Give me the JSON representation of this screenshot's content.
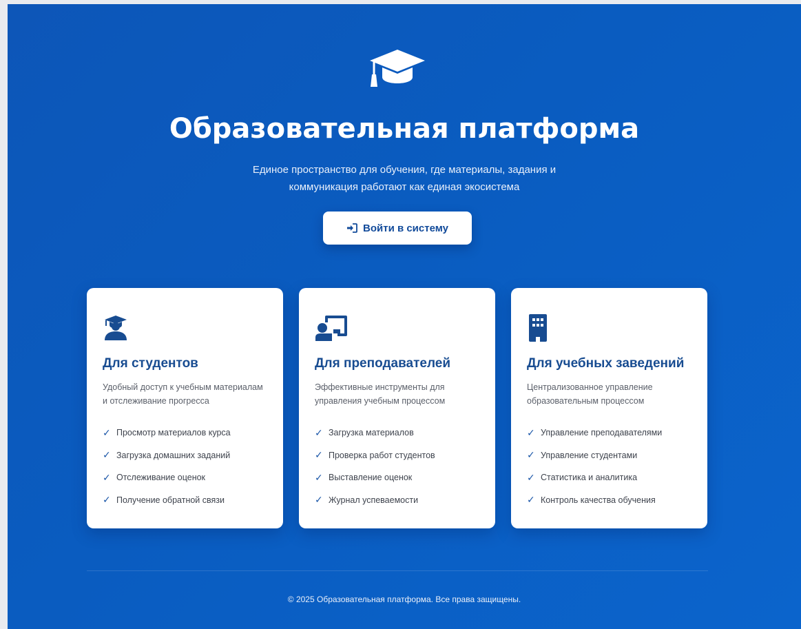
{
  "hero": {
    "icon": "graduation-cap-icon",
    "title": "Образовательная платформа",
    "subtitle": "Единое пространство для обучения, где материалы, задания и коммуникация работают как единая экосистема",
    "login_button": {
      "icon": "sign-in-icon",
      "label": "Войти в систему"
    }
  },
  "cards": [
    {
      "icon": "student-icon",
      "title": "Для студентов",
      "description": "Удобный доступ к учебным материалам и отслеживание прогресса",
      "features": [
        "Просмотр материалов курса",
        "Загрузка домашних заданий",
        "Отслеживание оценок",
        "Получение обратной связи"
      ]
    },
    {
      "icon": "teacher-icon",
      "title": "Для преподавателей",
      "description": "Эффективные инструменты для управления учебным процессом",
      "features": [
        "Загрузка материалов",
        "Проверка работ студентов",
        "Выставление оценок",
        "Журнал успеваемости"
      ]
    },
    {
      "icon": "building-icon",
      "title": "Для учебных заведений",
      "description": "Централизованное управление образовательным процессом",
      "features": [
        "Управление преподавателями",
        "Управление студентами",
        "Статистика и аналитика",
        "Контроль качества обучения"
      ]
    }
  ],
  "check_mark": "✓",
  "footer": {
    "text": "© 2025 Образовательная платформа. Все права защищены."
  },
  "colors": {
    "background": "#0b5cc0",
    "card": "#ffffff",
    "accent": "#184c91"
  }
}
